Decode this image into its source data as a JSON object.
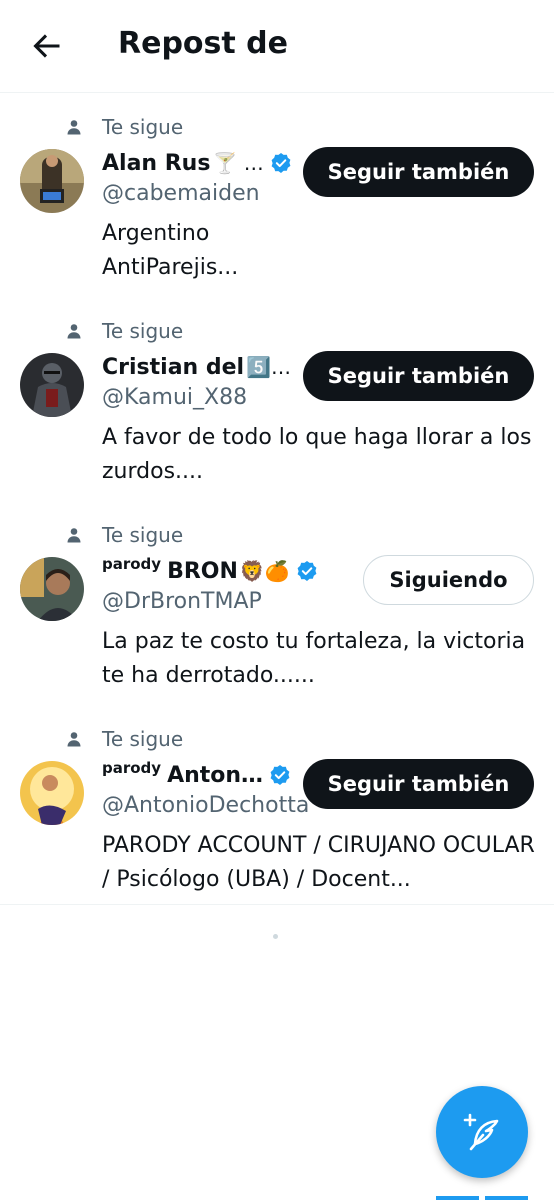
{
  "header": {
    "title": "Repost de"
  },
  "users": [
    {
      "follows_you": "Te sigue",
      "parody": "",
      "name": "Alan Rus",
      "emoji": "🍸 …",
      "verified": true,
      "handle": "@cabemaiden",
      "bio": "Argentino\nAntiParejis...",
      "button": "Seguir también",
      "following": false
    },
    {
      "follows_you": "Te sigue",
      "parody": "",
      "name": "Cristian del",
      "emoji": "5️⃣…",
      "verified": false,
      "handle": "@Kamui_X88",
      "bio": "A favor de todo lo que haga llorar a los zurdos....",
      "button": "Seguir también",
      "following": false
    },
    {
      "follows_you": "Te sigue",
      "parody": "parody",
      "name": "BRON",
      "emoji": "🦁🍊",
      "verified": true,
      "handle": "@DrBronTMAP",
      "bio": "La paz te costo tu fortaleza, la victoria te ha derrotado......",
      "button": "Siguiendo",
      "following": true
    },
    {
      "follows_you": "Te sigue",
      "parody": "parody",
      "name": "Anton…",
      "emoji": "",
      "verified": true,
      "handle": "@AntonioDechotta",
      "bio": "PARODY ACCOUNT / CIRUJANO OCULAR / Psicólogo (UBA) / Docent...",
      "button": "Seguir también",
      "following": false
    }
  ],
  "icons": {
    "back": "arrow-left-icon",
    "follows": "person-icon",
    "verified": "verified-badge-icon",
    "compose": "compose-feather-icon"
  },
  "colors": {
    "accent": "#1d9bf0",
    "text": "#0f1419",
    "secondary": "#536471",
    "follow_button": "#0f1419"
  }
}
